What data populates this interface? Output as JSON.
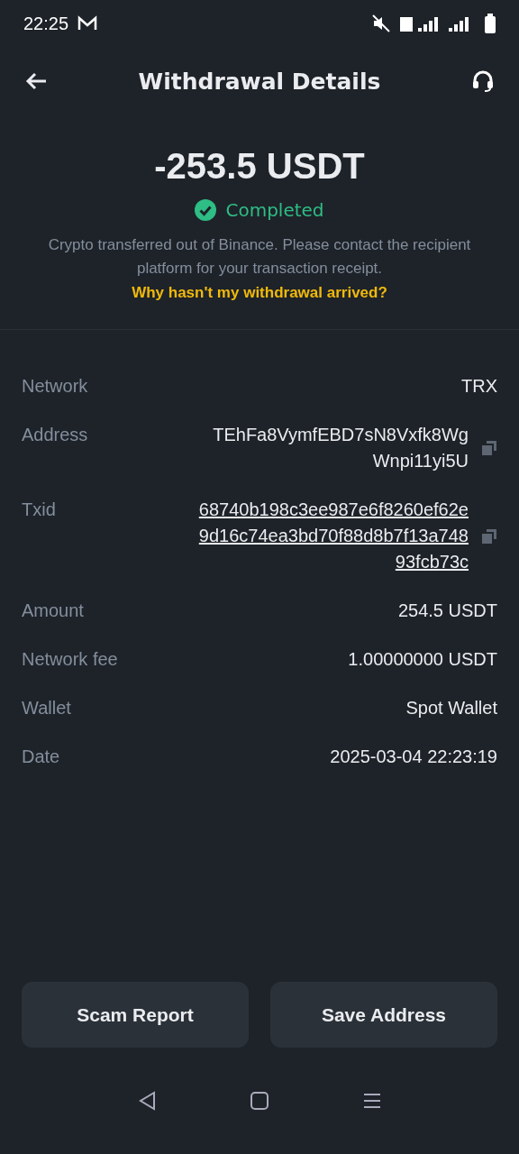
{
  "status_bar": {
    "time": "22:25"
  },
  "header": {
    "title": "Withdrawal Details"
  },
  "summary": {
    "amount": "-253.5 USDT",
    "status": {
      "label": "Completed",
      "kind": "completed"
    },
    "note": "Crypto transferred out of Binance. Please contact the recipient platform for your transaction receipt.",
    "help_link": "Why hasn't my withdrawal arrived?"
  },
  "details": [
    {
      "label": "Network",
      "value": "TRX",
      "kind": "plain"
    },
    {
      "label": "Address",
      "value": "TEhFa8VymfEBD7sN8Vxfk8WgWnpi11yi5U",
      "kind": "copy"
    },
    {
      "label": "Txid",
      "value": "68740b198c3ee987e6f8260ef62e9d16c74ea3bd70f88d8b7f13a74893fcb73c",
      "kind": "link"
    },
    {
      "label": "Amount",
      "value": "254.5 USDT",
      "kind": "plain"
    },
    {
      "label": "Network fee",
      "value": "1.00000000 USDT",
      "kind": "plain"
    },
    {
      "label": "Wallet",
      "value": "Spot Wallet",
      "kind": "plain"
    },
    {
      "label": "Date",
      "value": "2025-03-04 22:23:19",
      "kind": "plain"
    }
  ],
  "buttons": [
    "Scam Report",
    "Save Address"
  ]
}
